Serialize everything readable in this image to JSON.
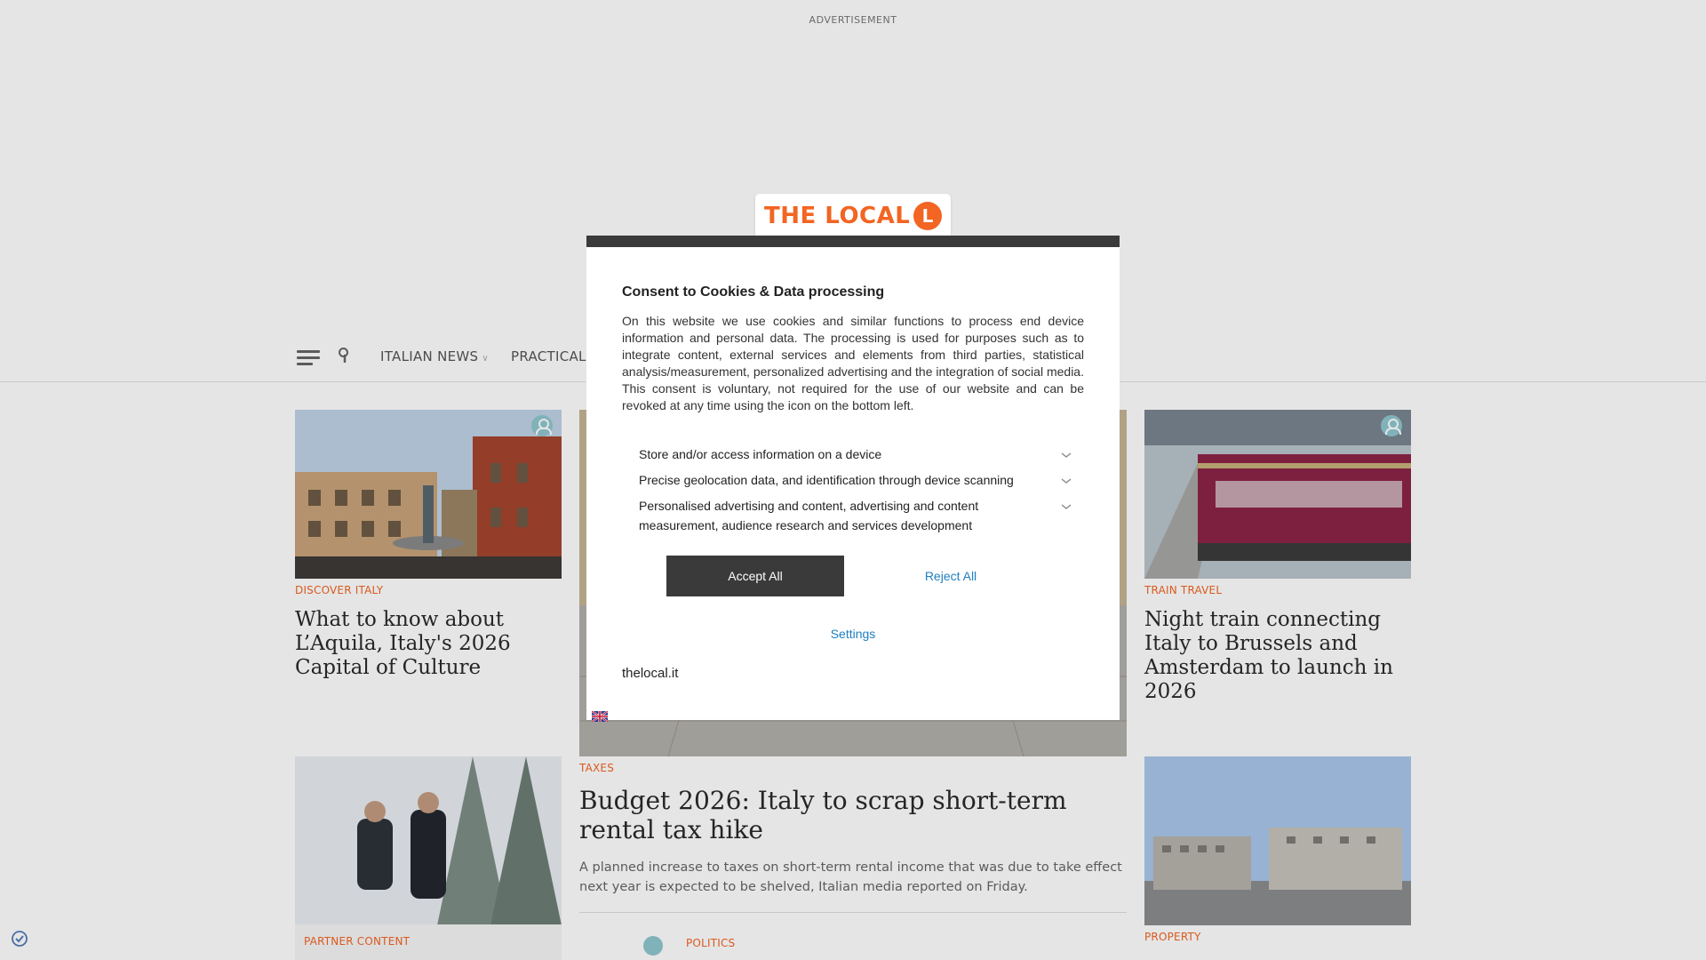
{
  "ad": {
    "label": "ADVERTISEMENT"
  },
  "nav": {
    "items": [
      {
        "label": "ITALIAN NEWS",
        "has_dropdown": true
      },
      {
        "label": "PRACTICAL",
        "has_dropdown": false
      }
    ]
  },
  "logo": {
    "text": "THE LOCAL",
    "mark": "L"
  },
  "colors": {
    "brand": "#f26522",
    "link": "#1e7fc1",
    "dark": "#3a3a3a",
    "overlay": "rgba(0,0,0,0.1)"
  },
  "cards": {
    "left_top": {
      "category": "DISCOVER ITALY",
      "headline": "What to know about L’Aquila, Italy's 2026 Capital of Culture"
    },
    "right_top": {
      "category": "TRAIN TRAVEL",
      "headline": "Night train connecting Italy to Brussels and Amsterdam to launch in 2026"
    },
    "center": {
      "category": "TAXES",
      "headline": "Budget 2026: Italy to scrap short-term rental tax hike",
      "summary": "A planned increase to taxes on short-term rental income that was due to take effect next year is expected to be shelved, Italian media reported on Friday."
    },
    "left_bottom": {
      "category": "PARTNER CONTENT"
    },
    "right_bottom": {
      "category": "PROPERTY"
    },
    "center_next": {
      "category": "POLITICS"
    }
  },
  "consent": {
    "title": "Consent to Cookies & Data processing",
    "body": "On this website we use cookies and similar functions to process end device information and personal data. The processing is used for purposes such as to integrate content, external services and elements from third parties, statistical analysis/measurement, personalized advertising and the integration of social media. This consent is voluntary, not required for the use of our website and can be revoked at any time using the icon on the bottom left.",
    "purposes": [
      "Store and/or access information on a device",
      "Precise geolocation data, and identification through device scanning",
      "Personalised advertising and content, advertising and content measurement, audience research and services development"
    ],
    "accept_label": "Accept All",
    "reject_label": "Reject All",
    "settings_label": "Settings",
    "site_name": "thelocal.it"
  }
}
